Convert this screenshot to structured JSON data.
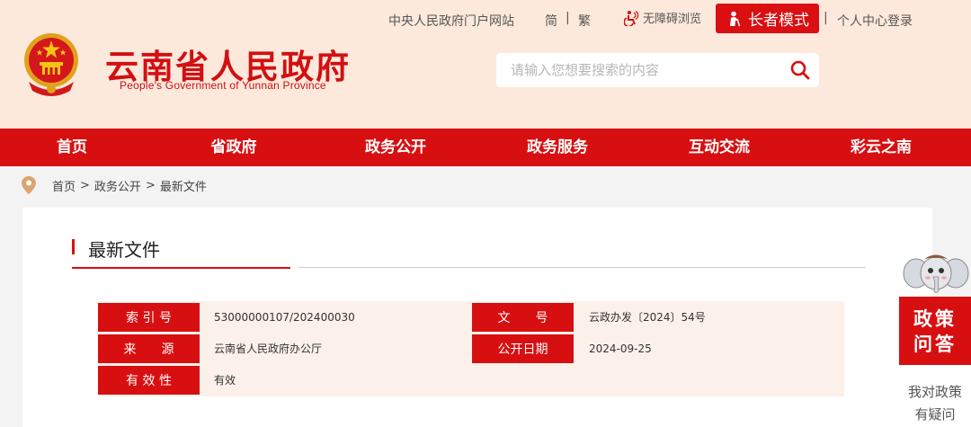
{
  "header": {
    "title": "云南省人民政府",
    "subtitle": "People's Government of Yunnan Province",
    "top_links": {
      "central_portal": "中央人民政府门户网站",
      "simplified": "简",
      "traditional": "繁",
      "accessible": "无障碍浏览",
      "elder_mode": "长者模式",
      "login": "个人中心登录",
      "separator": "|"
    },
    "search": {
      "placeholder": "请输入您想要搜索的内容",
      "value": ""
    }
  },
  "nav": {
    "items": [
      {
        "label": "首页"
      },
      {
        "label": "省政府"
      },
      {
        "label": "政务公开"
      },
      {
        "label": "政务服务"
      },
      {
        "label": "互动交流"
      },
      {
        "label": "彩云之南"
      }
    ]
  },
  "breadcrumb": {
    "items": [
      "首页",
      "政务公开",
      "最新文件"
    ],
    "separator": ">"
  },
  "section": {
    "title": "最新文件"
  },
  "info": {
    "index_label": "索 引 号",
    "index_value": "53000000107/202400030",
    "doc_no_label": "文　　号",
    "doc_no_value": "云政办发〔2024〕54号",
    "source_label": "来　　源",
    "source_value": "云南省人民政府办公厅",
    "date_label": "公开日期",
    "date_value": "2024-09-25",
    "validity_label": "有 效 性",
    "validity_value": "有效"
  },
  "floating": {
    "title_line1": "政策",
    "title_line2": "问答",
    "text_line1": "我对政策",
    "text_line2": "有疑问"
  },
  "colors": {
    "primary_red": "#d80f11",
    "header_bg": "#fde9db",
    "info_bg": "#fbf1ea"
  },
  "icons": [
    "national-emblem-icon",
    "accessibility-icon",
    "elder-person-icon",
    "search-icon",
    "location-pin-icon",
    "mascot-icon"
  ]
}
